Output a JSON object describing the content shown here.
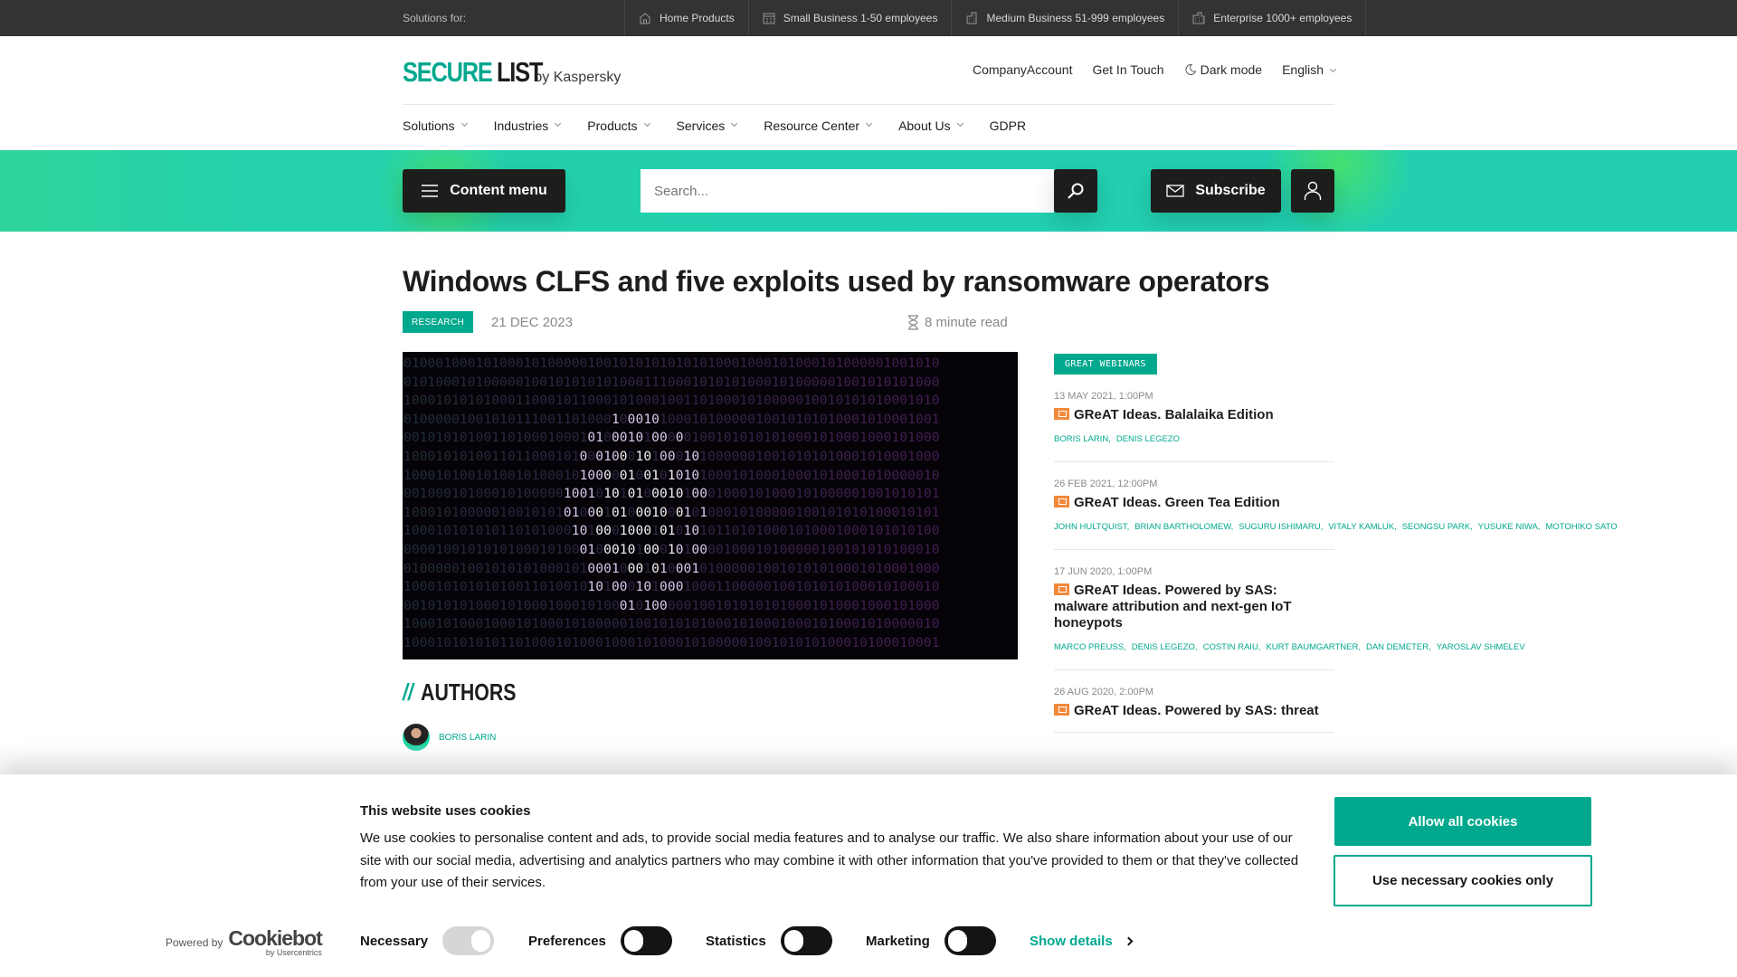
{
  "topbar": {
    "label": "Solutions for:",
    "segments": [
      {
        "icon": "house-icon",
        "label": "Home Products"
      },
      {
        "icon": "small-building-icon",
        "label": "Small Business 1-50 employees"
      },
      {
        "icon": "medium-building-icon",
        "label": "Medium Business 51-999 employees"
      },
      {
        "icon": "enterprise-building-icon",
        "label": "Enterprise 1000+ employees"
      }
    ]
  },
  "header": {
    "logo_part1": "SECURE",
    "logo_part2": "LIST",
    "logo_by": "by Kaspersky",
    "links": {
      "company_account": "CompanyAccount",
      "get_in_touch": "Get In Touch",
      "dark_mode": "Dark mode",
      "language": "English"
    }
  },
  "main_nav": [
    {
      "label": "Solutions",
      "dropdown": true
    },
    {
      "label": "Industries",
      "dropdown": true
    },
    {
      "label": "Products",
      "dropdown": true
    },
    {
      "label": "Services",
      "dropdown": true
    },
    {
      "label": "Resource Center",
      "dropdown": true
    },
    {
      "label": "About Us",
      "dropdown": true
    },
    {
      "label": "GDPR",
      "dropdown": false
    }
  ],
  "toolbar": {
    "content_menu": "Content menu",
    "search_placeholder": "Search...",
    "subscribe": "Subscribe"
  },
  "article": {
    "title": "Windows CLFS and five exploits used by ransomware operators",
    "tag": "RESEARCH",
    "date": "21 DEC 2023",
    "read_time": "8 minute read",
    "hero_rows": [
      "0100010001010001010000010010101010101010001000101000101000001001010",
      "0101000101000001001010101010001110001010101000101000001001010101000",
      "1000101010100011000101100010100010011010001010000010010101010001010",
      "0100000100101011100110100010001010001010000010010101010001010001001",
      "0010101010011010001000101000101000001001010101010001010001000101000",
      "1000101010011011000101000100010100010100000010010101010001010001000",
      "1000101001010010100010100000100101010100010100010001010001010000010",
      "0010001010001010000010010101010001010001000101000101000001001010101",
      "1000101000001001010101000101000100010100010100000100101010100010101",
      "1000101010101101010001010001000101010101101010001010001000101010100",
      "0000100101010100010100010001010001010000100010100000100101010100010",
      "0100000100101010100010100010001010001010000010010101010001010001000",
      "1000101010101001101001010100010100010001100000100101010100010100010",
      "0010101010001010001000101000101000001001010101010001010001000101000",
      "1000101000100010100010100000100101010100010100010001010001010000010",
      "1000101010101101000101000100010100010100000100101010100010100010001"
    ]
  },
  "authors": {
    "heading_prefix": "//",
    "heading": "AUTHORS",
    "list": [
      {
        "name": "BORIS LARIN"
      }
    ]
  },
  "sidebar": {
    "tag": "GREAT WEBINARS",
    "items": [
      {
        "date": "13 MAY 2021, 1:00PM",
        "title": "GReAT Ideas. Balalaika Edition",
        "authors": [
          "BORIS LARIN,",
          "DENIS LEGEZO"
        ]
      },
      {
        "date": "26 FEB 2021, 12:00PM",
        "title": "GReAT Ideas. Green Tea Edition",
        "authors": [
          "JOHN HULTQUIST,",
          "BRIAN BARTHOLOMEW,",
          "SUGURU ISHIMARU,",
          "VITALY KAMLUK,",
          "SEONGSU PARK,",
          "YUSUKE NIWA,",
          "MOTOHIKO SATO"
        ]
      },
      {
        "date": "17 JUN 2020, 1:00PM",
        "title": "GReAT Ideas. Powered by SAS: malware attribution and next-gen IoT honeypots",
        "authors": [
          "MARCO PREUSS,",
          "DENIS LEGEZO,",
          "COSTIN RAIU,",
          "KURT BAUMGARTNER,",
          "DAN DEMETER,",
          "YAROSLAV SHMELEV"
        ]
      },
      {
        "date": "26 AUG 2020, 2:00PM",
        "title": "GReAT Ideas. Powered by SAS: threat",
        "authors": []
      }
    ]
  },
  "cookie_banner": {
    "title": "This website uses cookies",
    "text": "We use cookies to personalise content and ads, to provide social media features and to analyse our traffic. We also share information about your use of our site with our social media, advertising and analytics partners who may combine it with other information that you've provided to them or that they've collected from your use of their services.",
    "powered_by": "Powered by",
    "cookiebot": "Cookiebot",
    "cookiebot_sub": "by Usercentrics",
    "toggles": [
      {
        "label": "Necessary",
        "state": "on-disabled"
      },
      {
        "label": "Preferences",
        "state": "off"
      },
      {
        "label": "Statistics",
        "state": "off"
      },
      {
        "label": "Marketing",
        "state": "off"
      }
    ],
    "show_details": "Show details",
    "allow_all": "Allow all cookies",
    "necessary_only": "Use necessary cookies only"
  },
  "colors": {
    "accent": "#00a88e",
    "topbar": "#333333",
    "dark_button": "#1d1d1b",
    "webinar_icon": "#f2893b"
  }
}
